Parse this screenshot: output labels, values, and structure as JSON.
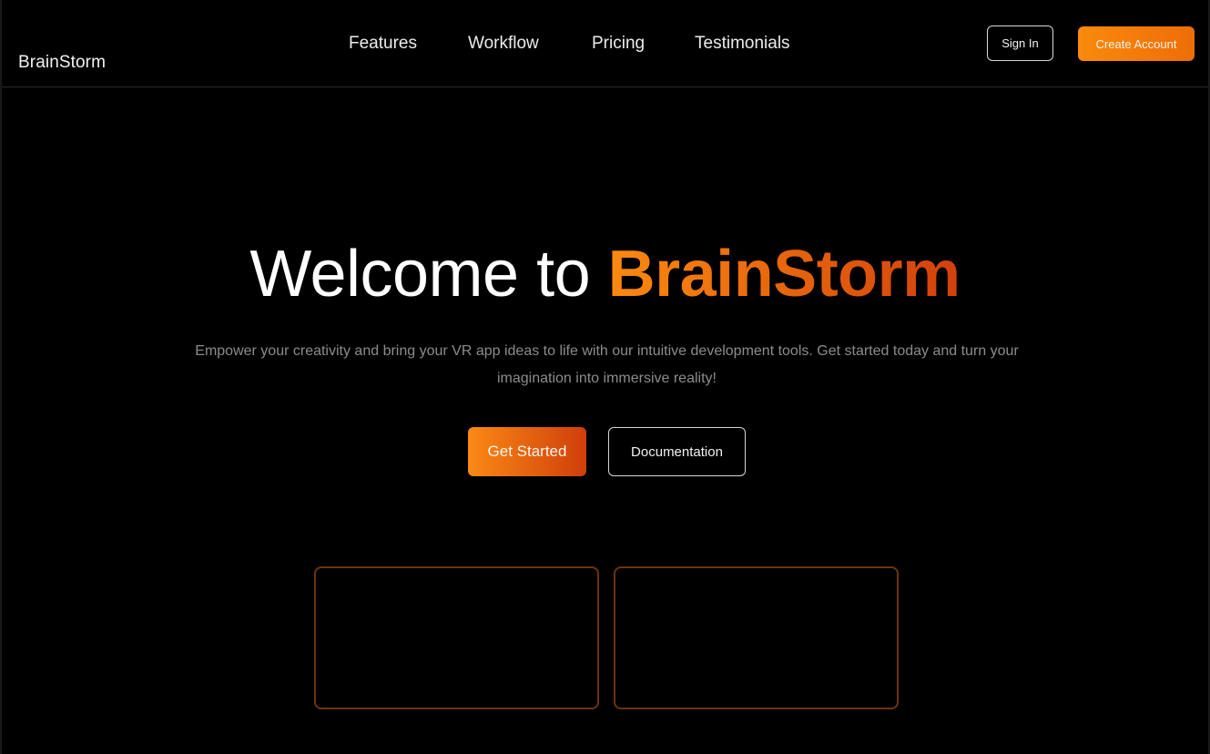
{
  "header": {
    "brand": "BrainStorm",
    "nav": [
      "Features",
      "Workflow",
      "Pricing",
      "Testimonials"
    ],
    "sign_in_label": "Sign In",
    "create_account_label": "Create Account"
  },
  "hero": {
    "title_prefix": "Welcome to ",
    "title_accent": "BrainStorm",
    "subtitle": "Empower your creativity and bring your VR app ideas to life with our intuitive development tools. Get started today and turn your imagination into immersive reality!",
    "primary_cta": "Get Started",
    "secondary_cta": "Documentation"
  },
  "colors": {
    "accent_start": "#fb8a0f",
    "accent_end": "#d2400c",
    "background": "#000000",
    "card_border": "#6b3410"
  }
}
